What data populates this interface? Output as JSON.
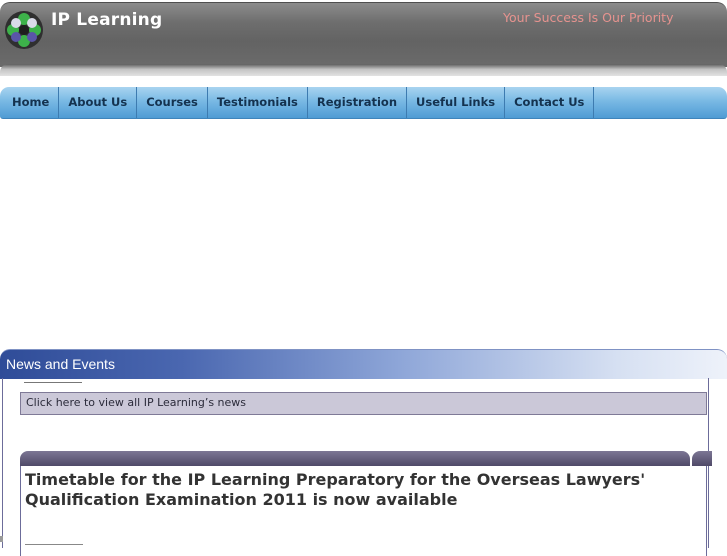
{
  "header": {
    "brand": "IP Learning",
    "tagline": "Your Success Is Our Priority"
  },
  "nav": {
    "items": [
      "Home",
      "About Us",
      "Courses",
      "Testimonials",
      "Registration",
      "Useful Links",
      "Contact Us"
    ]
  },
  "news": {
    "heading": "News and Events",
    "view_all_link": "Click here to view all IP Learning’s news",
    "item_title": "Timetable for the IP Learning Preparatory for the Overseas Lawyers' Qualification Examination 2011 is now available"
  },
  "colors": {
    "tagline": "#e6938f",
    "nav_text": "#14324f",
    "header_bg": "#6e6e6e",
    "nav_bg": "#79b9e4"
  }
}
